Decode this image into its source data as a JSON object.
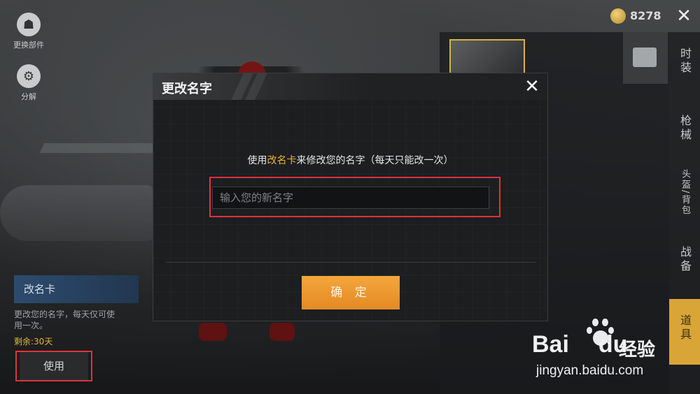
{
  "top_bar": {
    "coin_value": "8278",
    "close_symbol": "✕"
  },
  "left_tools": [
    {
      "label": "更换部件",
      "icon": "emblem-icon"
    },
    {
      "label": "分解",
      "icon": "gear-icon"
    }
  ],
  "item_card": {
    "title": "改名卡",
    "description": "更改您的名字，每天仅可使用一次。",
    "remaining": "剩余:30天",
    "use_label": "使用"
  },
  "side_tabs": [
    {
      "label": "时装"
    },
    {
      "label": "枪械"
    },
    {
      "label": "头盔/背包"
    },
    {
      "label": "战备"
    },
    {
      "label": "道具"
    }
  ],
  "dialog": {
    "title": "更改名字",
    "close_symbol": "✕",
    "message_prefix": "使用",
    "message_highlight": "改名卡",
    "message_suffix": "来修改您的名字（每天只能改一次）",
    "input_placeholder": "输入您的新名字",
    "confirm_label": "确 定"
  },
  "watermark": {
    "brand_latin": "Bai",
    "brand_latin2": "du",
    "brand_cn": "经验",
    "url": "jingyan.baidu.com"
  },
  "colors": {
    "accent_gold": "#e7b43b",
    "confirm_orange": "#f09a32",
    "highlight_red": "#e0323a",
    "active_tab": "#d9a536"
  }
}
